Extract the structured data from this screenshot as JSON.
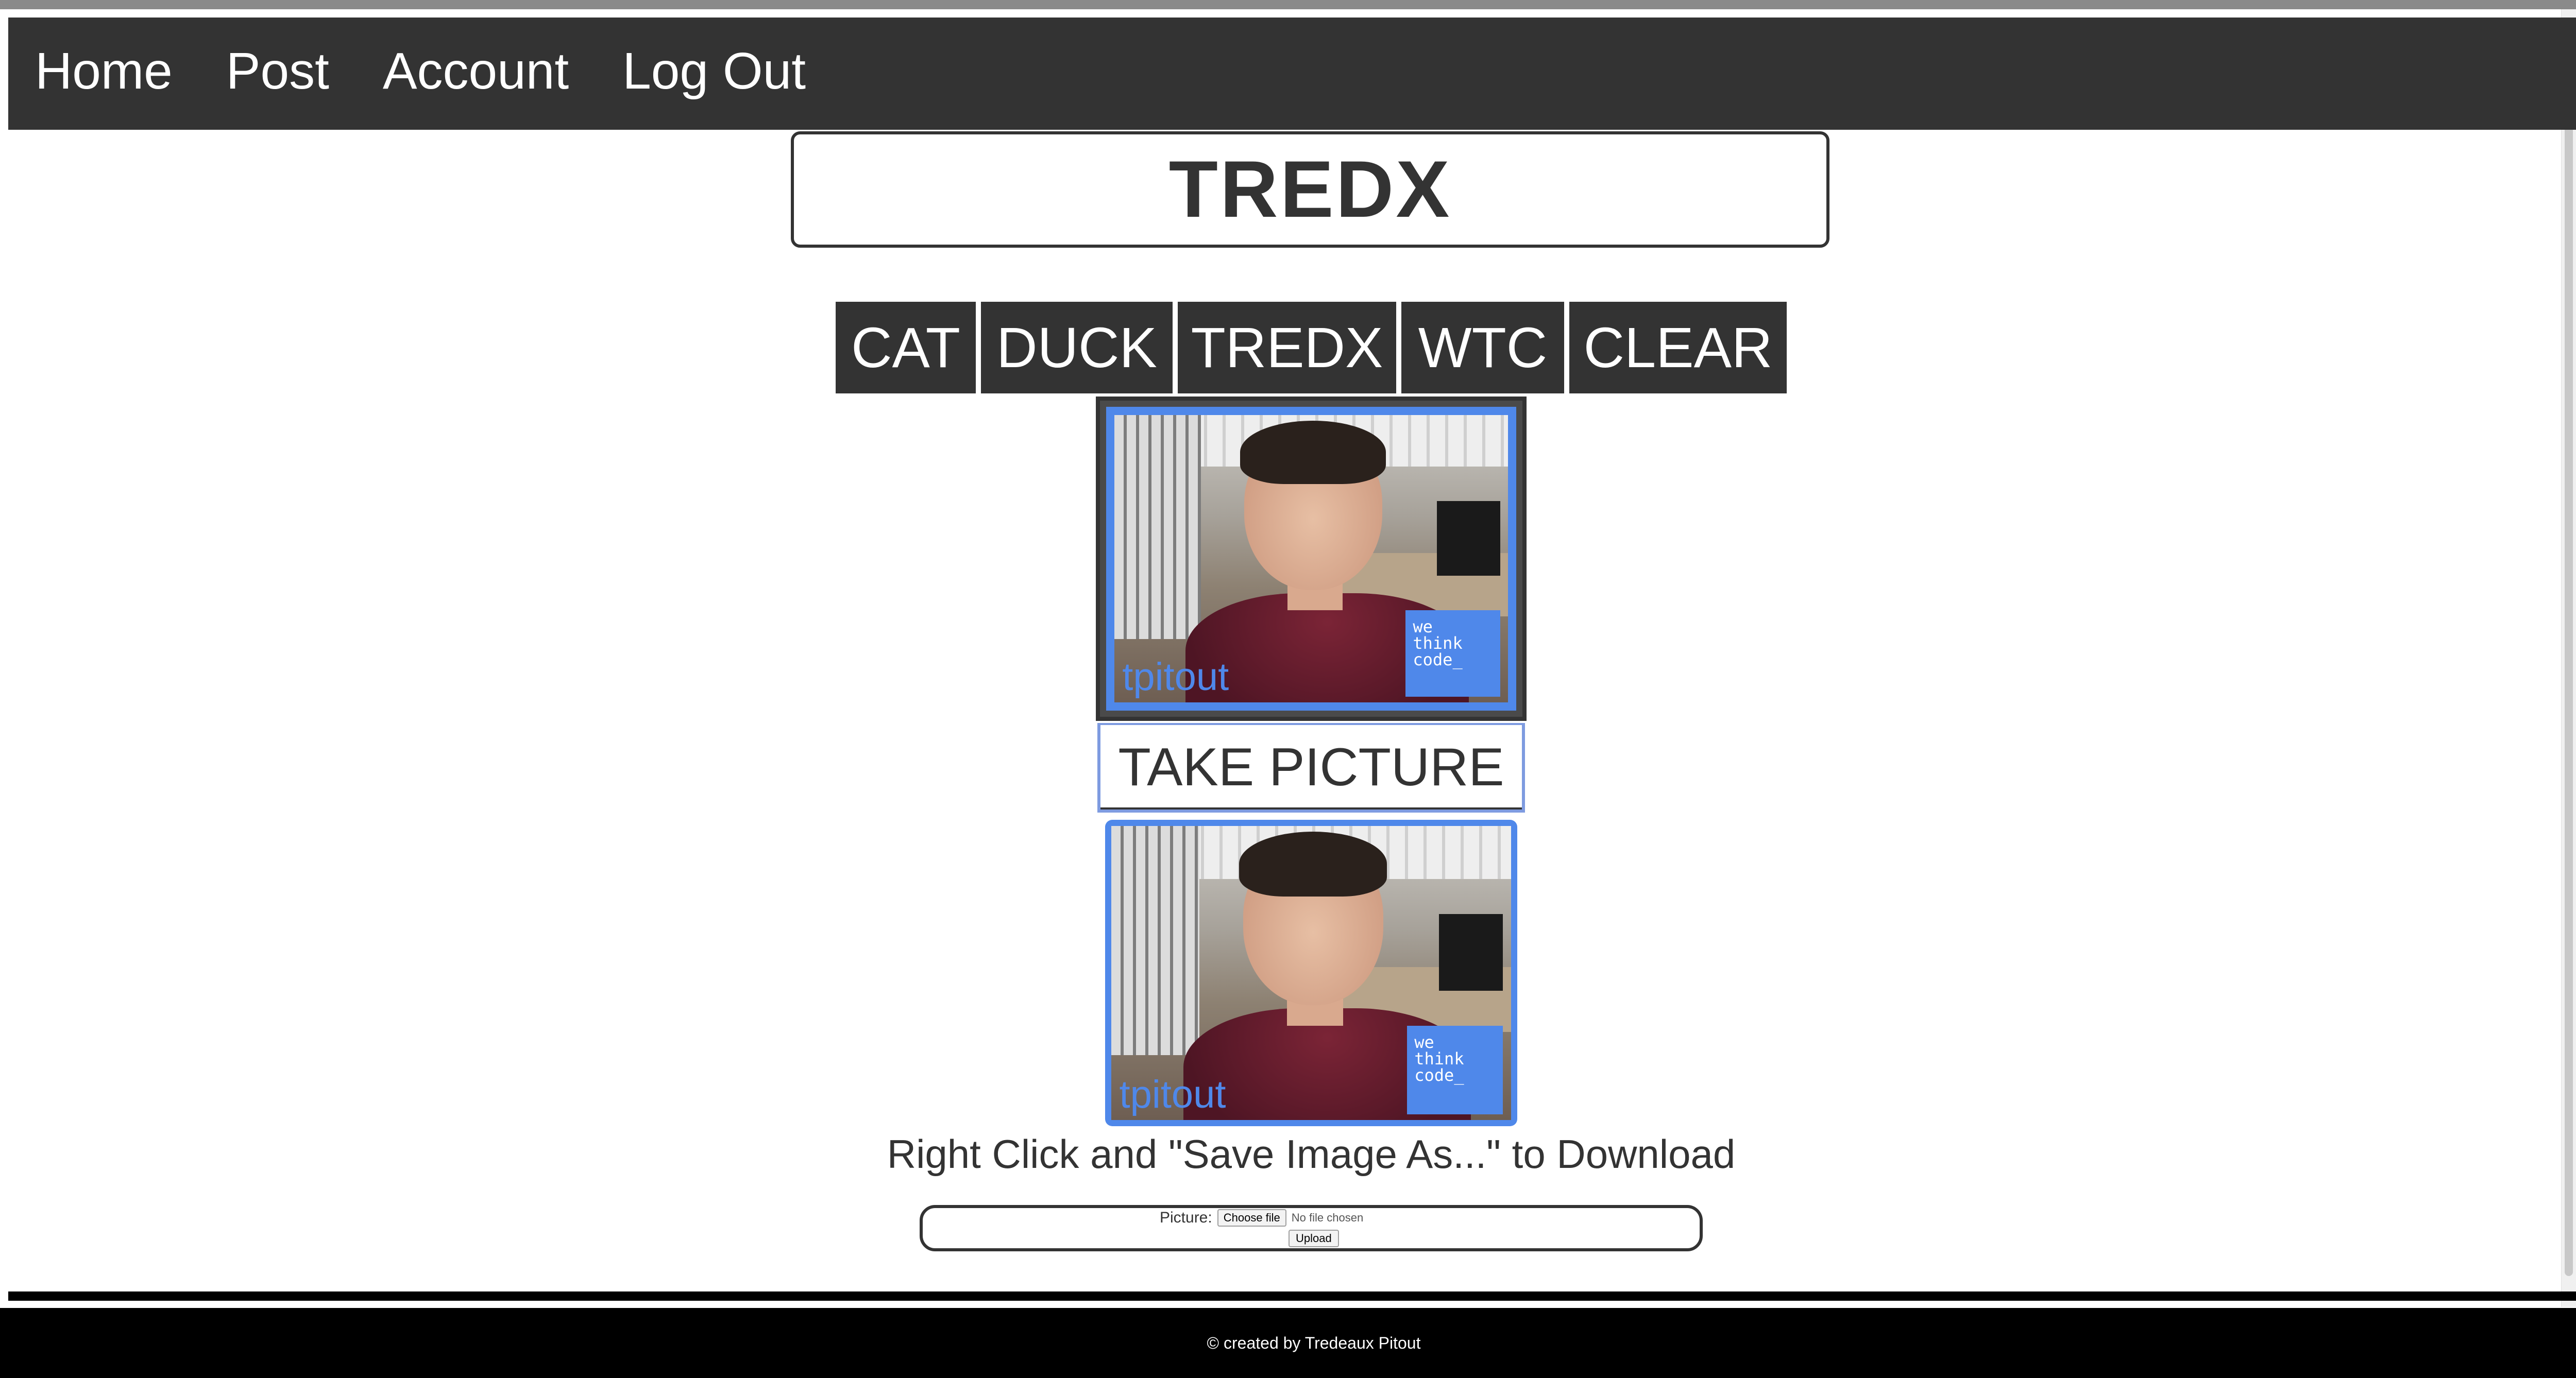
{
  "nav": {
    "items": [
      {
        "label": "Home"
      },
      {
        "label": "Post"
      },
      {
        "label": "Account"
      },
      {
        "label": "Log Out"
      }
    ]
  },
  "header": {
    "title": "TREDX"
  },
  "filters": {
    "buttons": [
      {
        "label": "CAT"
      },
      {
        "label": "DUCK"
      },
      {
        "label": "TREDX"
      },
      {
        "label": "WTC"
      },
      {
        "label": "CLEAR"
      }
    ]
  },
  "camera": {
    "overlay_logo_lines": [
      "we",
      "think",
      "code_"
    ],
    "overlay_signature": "tpitout"
  },
  "capture": {
    "take_label": "TAKE PICTURE"
  },
  "result": {
    "overlay_logo_lines": [
      "we",
      "think",
      "code_"
    ],
    "overlay_signature": "tpitout",
    "download_note": "Right Click and \"Save Image As...\" to Download"
  },
  "upload": {
    "label": "Picture:",
    "choose_label": "Choose file",
    "no_file_text": "No file chosen",
    "submit_label": "Upload"
  },
  "footer": {
    "text": "© created by Tredeaux Pitout"
  },
  "colors": {
    "nav_bg": "#333333",
    "accent_blue": "#4f88ea",
    "footer_bg": "#000000"
  }
}
